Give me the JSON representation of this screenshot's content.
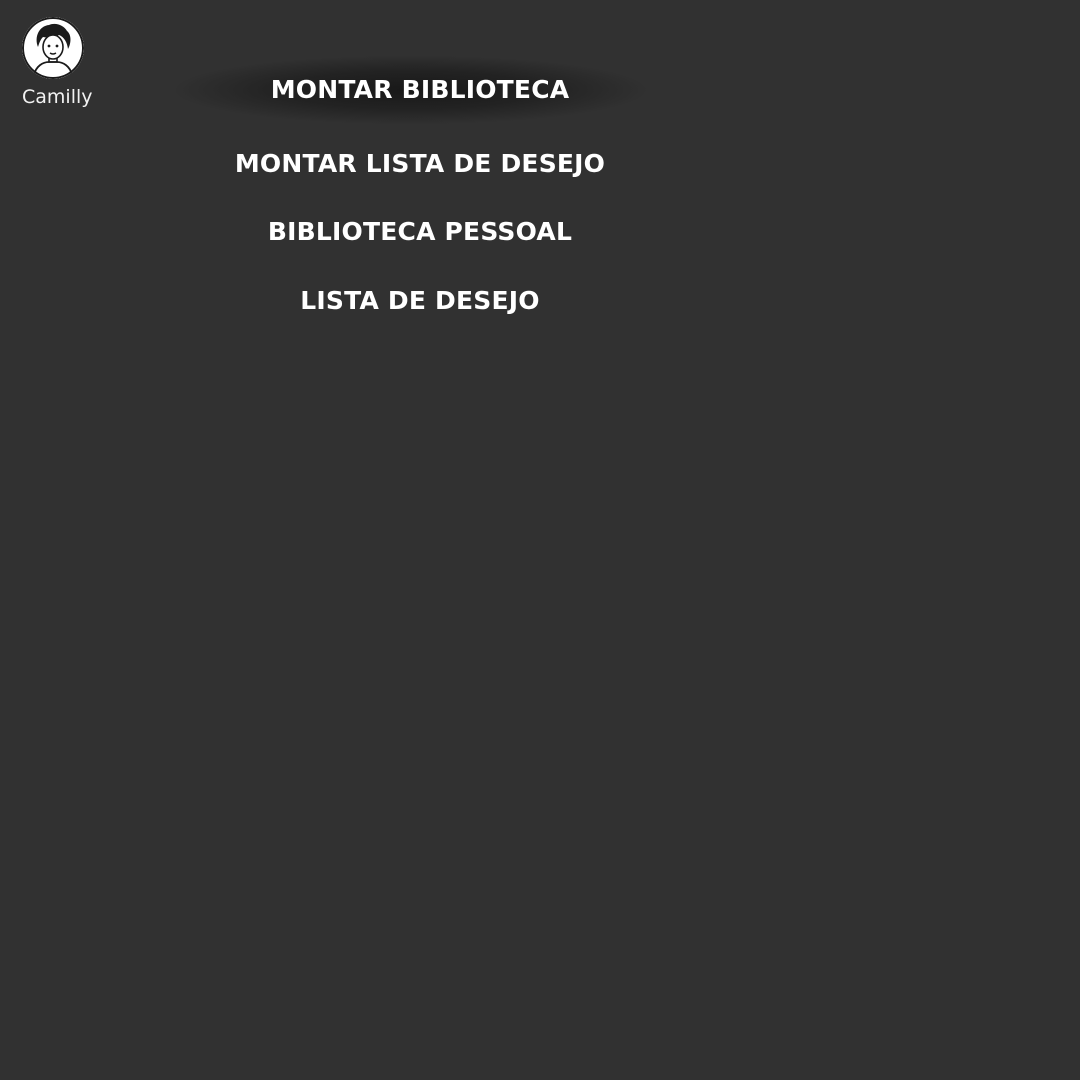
{
  "user": {
    "name": "Camilly",
    "avatar_icon": "person-avatar-icon"
  },
  "menu": {
    "items": [
      {
        "label": "MONTAR BIBLIOTECA",
        "active": true
      },
      {
        "label": "MONTAR LISTA DE DESEJO",
        "active": false
      },
      {
        "label": "BIBLIOTECA PESSOAL",
        "active": false
      },
      {
        "label": "LISTA DE DESEJO",
        "active": false
      }
    ]
  },
  "colors": {
    "background": "#313131",
    "text": "#ffffff",
    "hover_glow": "#1a1a1a"
  }
}
